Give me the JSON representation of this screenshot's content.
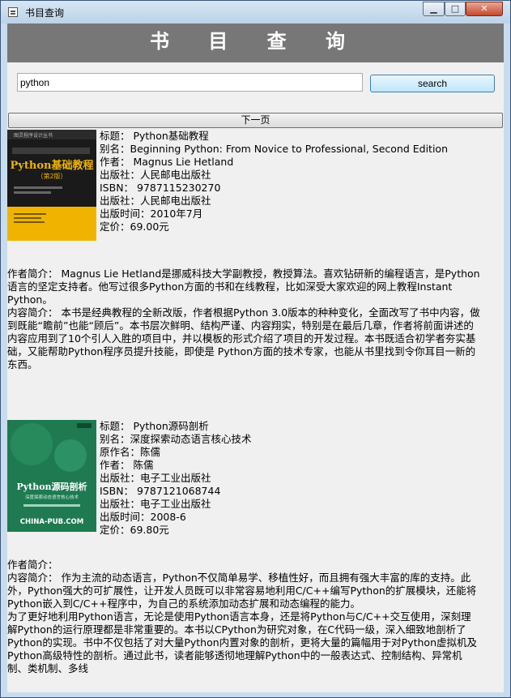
{
  "window": {
    "title": "书目查询",
    "min_label": "▁",
    "max_label": "□",
    "close_label": "✕"
  },
  "header": {
    "title": "书 目 查 询"
  },
  "search": {
    "value": "python",
    "button_label": "search"
  },
  "pager": {
    "next_label": "下一页"
  },
  "books": [
    {
      "cover": {
        "series": "图灵程序设计丛书",
        "title": "Python基础教程",
        "edition": "（第2版）",
        "bg": "#1a1a1a",
        "accent": "#f0b400"
      },
      "lines": [
        "标题：  Python基础教程",
        "别名：Beginning Python: From Novice to Professional, Second Edition",
        "作者：  Magnus Lie Hetland",
        "出版社：人民邮电出版社",
        "ISBN：  9787115230270",
        "出版社：人民邮电出版社",
        "出版时间：2010年7月",
        "定价：69.00元"
      ],
      "desc": [
        "作者简介： Magnus Lie Hetland是挪威科技大学副教授，教授算法。喜欢钻研新的编程语言，是Python语言的坚定支持者。他写过很多Python方面的书和在线教程，比如深受大家欢迎的网上教程Instant Python。",
        "内容简介： 本书是经典教程的全新改版，作者根据Python 3.0版本的种种变化，全面改写了书中内容，做到既能“瞻前”也能“顾后”。本书层次鲜明、结构严谨、内容翔实，特别是在最后几章，作者将前面讲述的内容应用到了10个引人入胜的项目中，并以模板的形式介绍了项目的开发过程。本书既适合初学者夯实基础，又能帮助Python程序员提升技能，即使是 Python方面的技术专家，也能从书里找到令你耳目一新的东西。"
      ]
    },
    {
      "cover": {
        "title": "Python源码剖析",
        "subtitle": "深度探索动态语言核心技术",
        "brand": "CHINA-PUB.COM",
        "bg": "#1f7a52",
        "accent": "#ffffff"
      },
      "lines": [
        "标题：  Python源码剖析",
        "别名：深度探索动态语言核心技术",
        "原作名：陈儒",
        "作者：  陈儒",
        "出版社：电子工业出版社",
        "ISBN：  9787121068744",
        "出版社：电子工业出版社",
        "出版时间：2008-6",
        "定价：69.80元"
      ],
      "desc": [
        "作者简介：",
        "内容简介： 作为主流的动态语言，Python不仅简单易学、移植性好，而且拥有强大丰富的库的支持。此外，Python强大的可扩展性，让开发人员既可以非常容易地利用C/C++编写Python的扩展模块，还能将Python嵌入到C/C++程序中，为自己的系统添加动态扩展和动态编程的能力。",
        "为了更好地利用Python语言，无论是使用Python语言本身，还是将Python与C/C++交互使用，深刻理解Python的运行原理都是非常重要的。本书以CPython为研究对象，在C代码一级，深入细致地剖析了Python的实现。书中不仅包括了对大量Python内置对象的剖析，更将大量的篇幅用于对Python虚拟机及Python高级特性的剖析。通过此书，读者能够透彻地理解Python中的一般表达式、控制结构、异常机制、类机制、多线"
      ]
    }
  ]
}
